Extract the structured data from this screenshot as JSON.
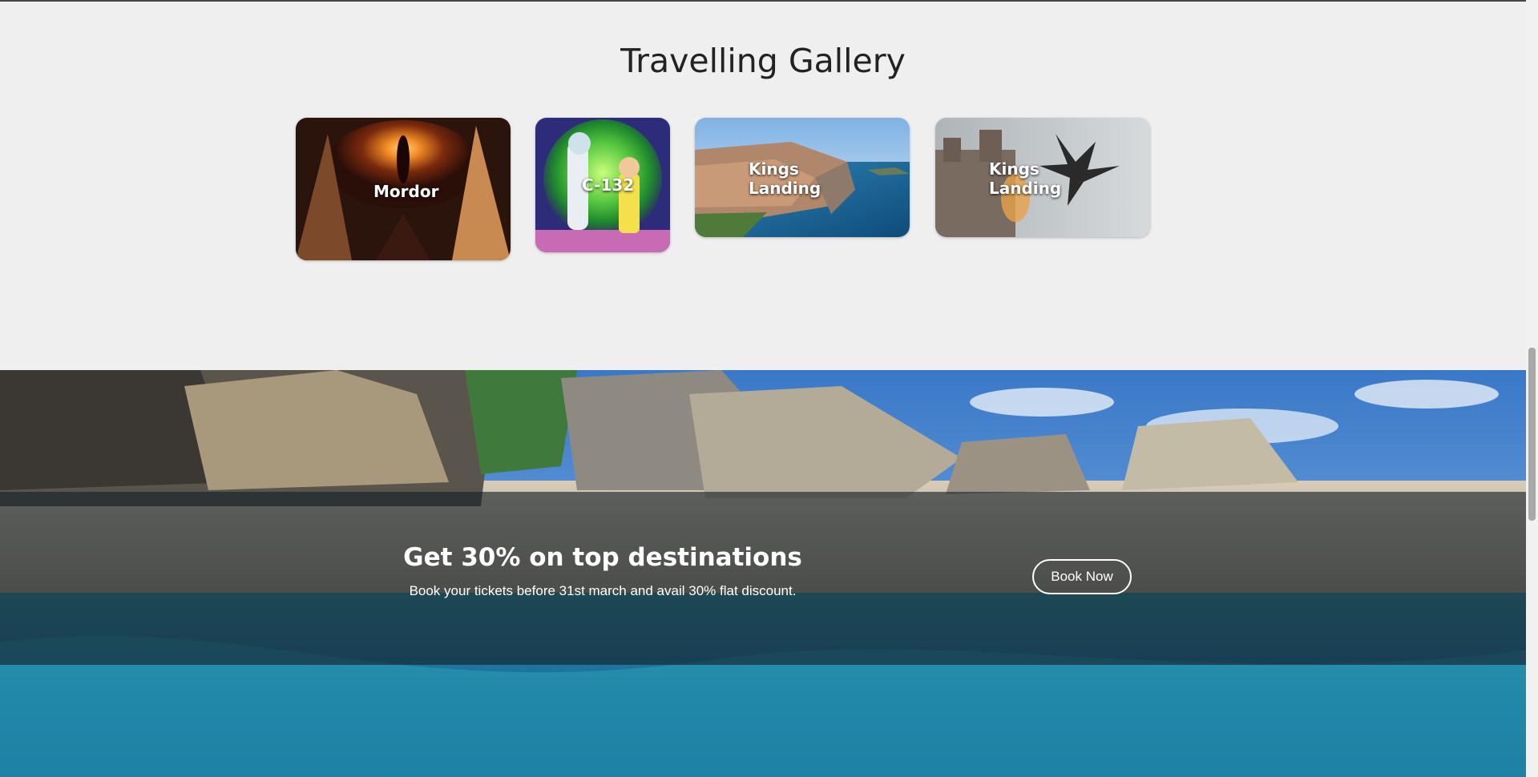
{
  "gallery": {
    "title": "Travelling Gallery",
    "cards": [
      {
        "label": "Mordor"
      },
      {
        "label": "C-132"
      },
      {
        "label_line1": "Kings",
        "label_line2": "Landing"
      },
      {
        "label_line1": "Kings",
        "label_line2": "Landing"
      }
    ]
  },
  "promo": {
    "title": "Get 30% on top destinations",
    "text": "Book your tickets before 31st march and avail 30% flat discount.",
    "button_label": "Book Now"
  },
  "colors": {
    "page_background": "#efefef",
    "text_dark": "#222222",
    "text_light": "#ffffff",
    "overlay": "rgba(20,30,40,0.62)"
  }
}
